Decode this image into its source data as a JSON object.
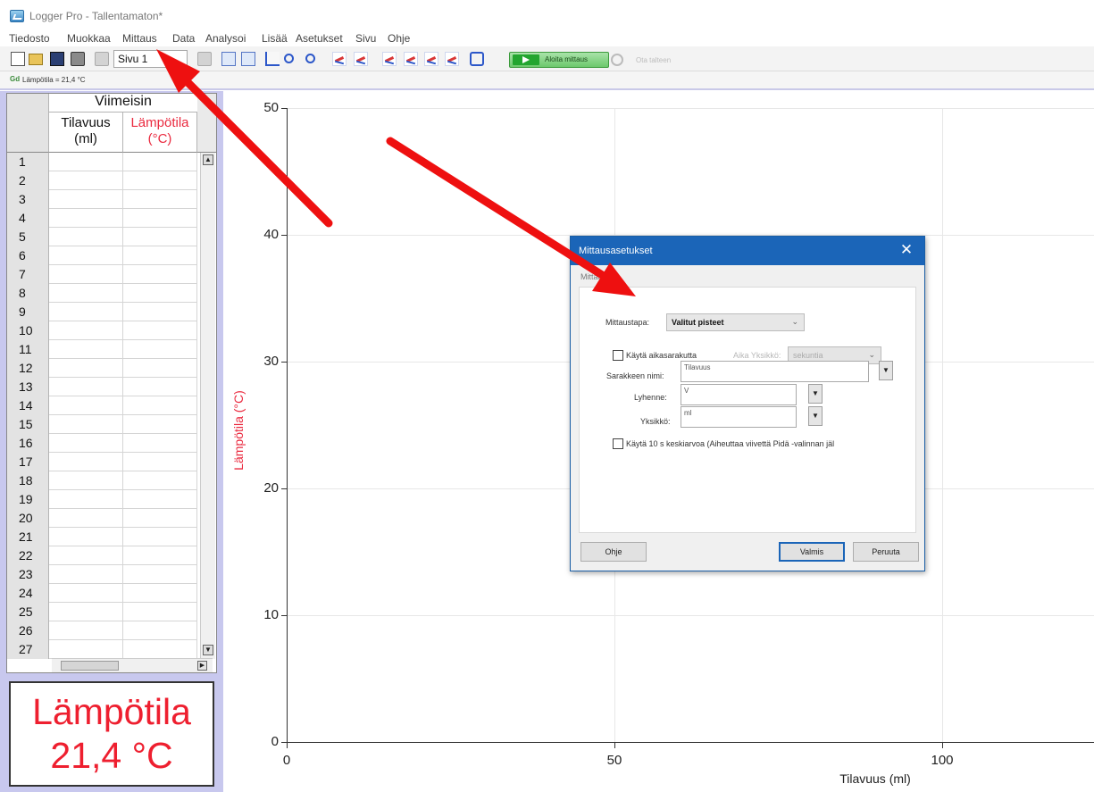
{
  "window": {
    "title": "Logger Pro - Tallentamaton*"
  },
  "menu": [
    "Tiedosto",
    "Muokkaa",
    "Mittaus",
    "Data",
    "Analysoi",
    "Lisää",
    "Asetukset",
    "Sivu",
    "Ohje"
  ],
  "toolbar": {
    "page_select": "Sivu 1",
    "start_label": "Aloita mittaus",
    "keep_label": "Ota talteen"
  },
  "status": {
    "sensor_readout": "Lämpötila = 21,4 °C",
    "sensor_icon": "Gd"
  },
  "table": {
    "group_title": "Viimeisin",
    "col_volume": "Tilavuus\n(ml)",
    "col_temp": "Lämpötila\n(°C)",
    "rows": [
      "1",
      "2",
      "3",
      "4",
      "5",
      "6",
      "7",
      "8",
      "9",
      "10",
      "11",
      "12",
      "13",
      "14",
      "15",
      "16",
      "17",
      "18",
      "19",
      "20",
      "21",
      "22",
      "23",
      "24",
      "25",
      "26",
      "27"
    ]
  },
  "meter": {
    "name": "Lämpötila",
    "value": "21,4 °C"
  },
  "graph": {
    "ylabel": "Lämpötila (°C)",
    "xlabel": "Tilavuus (ml)",
    "y_ticks": [
      "50",
      "40",
      "30",
      "20",
      "10",
      "0"
    ],
    "x_ticks": [
      "0",
      "50",
      "100"
    ]
  },
  "dialog": {
    "title": "Mittausasetukset",
    "close_glyph": "✕",
    "tab": "Mittaus",
    "mode_label": "Mittaustapa:",
    "mode_value": "Valitut pisteet",
    "timebase_label": "Käytä aikasarakutta",
    "time_unit_label": "Aika Yksikkö:",
    "time_unit_value": "sekuntia",
    "column_name_label": "Sarakkeen nimi:",
    "column_name_value": "Tilavuus",
    "short_label": "Lyhenne:",
    "short_value": "V",
    "unit_label": "Yksikkö:",
    "unit_value": "ml",
    "average_label": "Käytä 10 s keskiarvoa (Aiheuttaa viivettä Pidä -valinnan jäl",
    "help_button": "Ohje",
    "ok_button": "Valmis",
    "cancel_button": "Peruuta"
  },
  "annotation": {
    "color": "#ee1010"
  }
}
